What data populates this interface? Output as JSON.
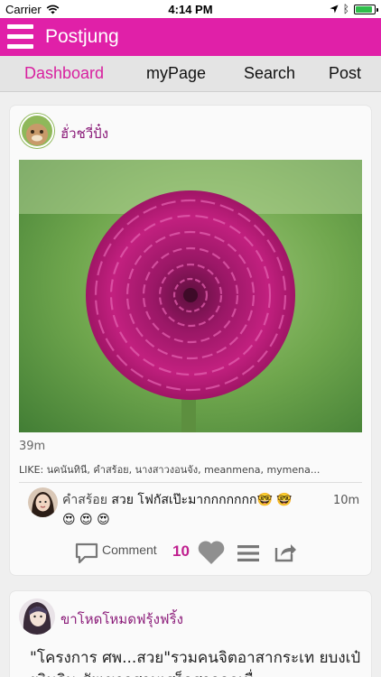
{
  "status_bar": {
    "carrier": "Carrier",
    "time": "4:14 PM",
    "battery_level": 0.92
  },
  "app_bar": {
    "title": "Postjung",
    "menu_icon": "hamburger-menu-icon"
  },
  "tabs": [
    {
      "label": "Dashboard",
      "active": true
    },
    {
      "label": "myPage",
      "active": false
    },
    {
      "label": "Search",
      "active": false
    },
    {
      "label": "Post",
      "active": false
    }
  ],
  "posts": [
    {
      "username": "ฮั่วชวี่ปั๋ง",
      "time_ago": "39m",
      "likes_text": "LIKE: นคนันทินี, คําสร้อย, นางสาวงอนจัง, meanmena, mymena...",
      "comment": {
        "username": "คำสร้อย",
        "text": "สวย โฟกัสเป๊ะมากกกกกกก🤓 🤓 😍 😍 😍",
        "time": "10m"
      },
      "actions": {
        "comment_label": "Comment",
        "like_count": "10"
      }
    },
    {
      "username": "ขาโหดโหมดฟรุ้งฟริ้ง",
      "caption": "\"โครงการ ศพ...สวย\"รวมคนจิตอาสากระเท ยบงเป๋ยงินจิน สัยเขาวสามเสร็อสาออกเนื่"
    }
  ],
  "colors": {
    "brand": "#e020a8",
    "active_tab": "#d81f9f",
    "username": "#8a1a78",
    "like_count": "#c0208f"
  }
}
